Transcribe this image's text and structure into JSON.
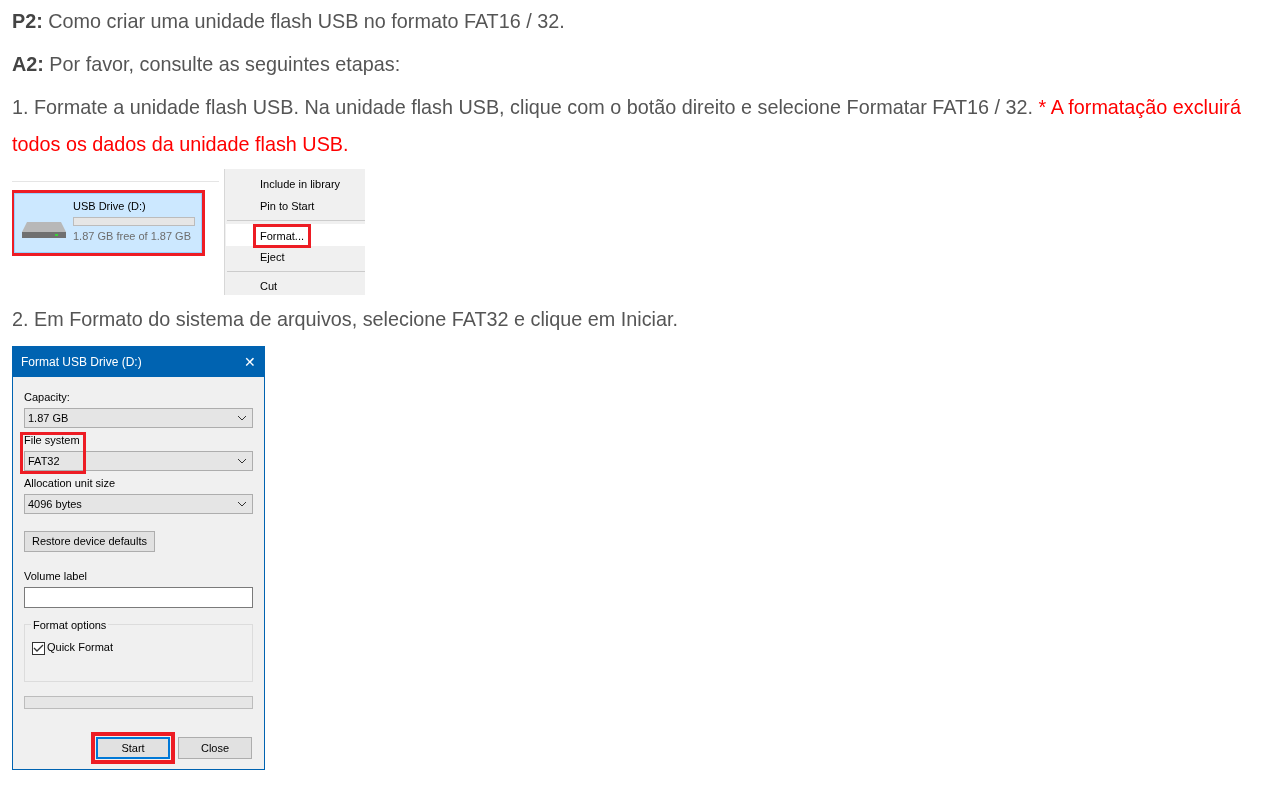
{
  "content": [
    {
      "kind": "paragraph",
      "text": "**P2:** Como criar uma unidade flash USB no formato FAT16 / 32."
    },
    {
      "kind": "paragraph",
      "text": "**A2:** Por favor, consulte as seguintes etapas:"
    },
    {
      "kind": "paragraph",
      "text": "1. Formate a unidade flash USB. Na unidade flash USB, clique com o botão direito e selecione Formatar FAT16 / 32.",
      "warning": "* A formatação excluirá todos os dados da unidade flash USB."
    },
    {
      "kind": "explorer",
      "drive": {
        "name": "USB Drive (D:)",
        "free": "1.87 GB free of 1.87 GB",
        "level": 0,
        "highlighted": true
      },
      "menu": [
        {
          "kind": "item",
          "label": "Include in library",
          "selected": false,
          "highlighted": false
        },
        {
          "kind": "item",
          "label": "Pin to Start",
          "selected": false,
          "highlighted": false
        },
        {
          "kind": "separator"
        },
        {
          "kind": "item",
          "label": "Format...",
          "selected": true,
          "highlighted": true
        },
        {
          "kind": "item",
          "label": "Eject",
          "selected": false,
          "highlighted": false
        },
        {
          "kind": "separator"
        },
        {
          "kind": "item",
          "label": "Cut",
          "selected": false,
          "highlighted": false
        }
      ]
    },
    {
      "kind": "paragraph",
      "text": "2. Em Formato do sistema de arquivos, selecione FAT32 e clique em Iniciar."
    },
    {
      "kind": "dialog",
      "title": "Format USB Drive (D:)",
      "close": "✕",
      "fields": [
        {
          "kind": "select",
          "label": "Capacity:",
          "value": "1.87 GB",
          "highlighted": false
        },
        {
          "kind": "select",
          "label": "File system",
          "value": "FAT32",
          "highlighted": true
        },
        {
          "kind": "select",
          "label": "Allocation unit size",
          "value": "4096 bytes",
          "highlighted": false
        },
        {
          "kind": "button",
          "label": "Restore device defaults"
        },
        {
          "kind": "text",
          "label": "Volume label"
        }
      ],
      "group": {
        "title": "Format options",
        "checkboxes": [
          {
            "label": "Quick Format",
            "checked": true
          }
        ]
      },
      "progress": {
        "level": 0
      },
      "buttons": [
        {
          "label": "Start",
          "highlighted": true
        },
        {
          "label": "Close",
          "highlighted": false
        }
      ]
    }
  ]
}
